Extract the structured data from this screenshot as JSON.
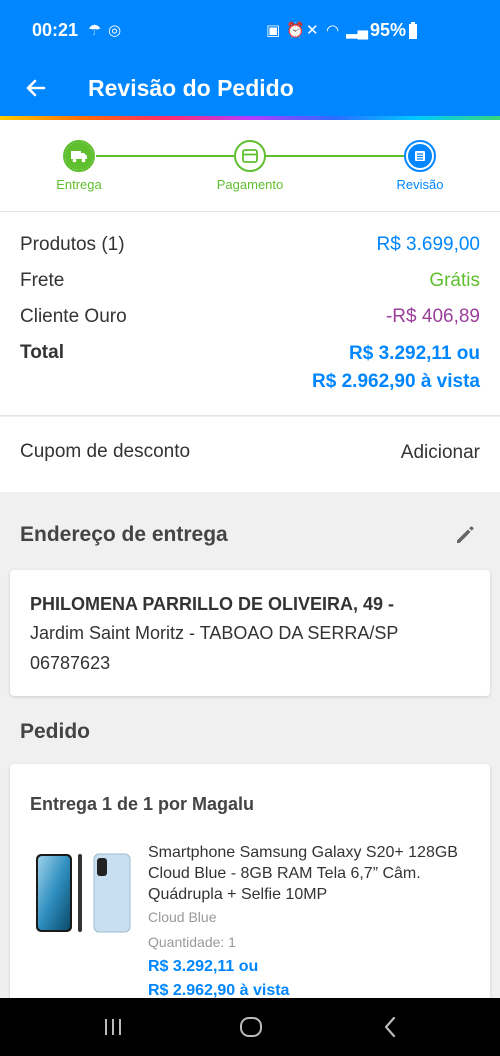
{
  "status_bar": {
    "time": "00:21",
    "battery": "95%"
  },
  "app_bar": {
    "title": "Revisão do Pedido"
  },
  "stepper": {
    "steps": [
      {
        "label": "Entrega"
      },
      {
        "label": "Pagamento"
      },
      {
        "label": "Revisão"
      }
    ]
  },
  "summary": {
    "products_label": "Produtos (1)",
    "products_value": "R$ 3.699,00",
    "shipping_label": "Frete",
    "shipping_value": "Grátis",
    "gold_label": "Cliente Ouro",
    "gold_value": "-R$ 406,89",
    "total_label": "Total",
    "total_value_1": "R$ 3.292,11 ou",
    "total_value_2": "R$ 2.962,90 à vista"
  },
  "coupon": {
    "label": "Cupom de desconto",
    "action": "Adicionar"
  },
  "address_section": {
    "title": "Endereço de entrega",
    "line1": "PHILOMENA PARRILLO DE OLIVEIRA, 49 -",
    "line2": "Jardim Saint Moritz - TABOAO DA SERRA/SP",
    "line3": "06787623"
  },
  "order_section": {
    "title": "Pedido",
    "delivery_title": "Entrega 1 de 1 por Magalu",
    "product_name": "Smartphone Samsung Galaxy S20+ 128GB Cloud Blue - 8GB RAM Tela 6,7” Câm. Quádrupla + Selfie 10MP",
    "variant": "Cloud Blue",
    "quantity": "Quantidade:  1",
    "price_1": "R$ 3.292,11 ou",
    "price_2": "R$ 2.962,90 à vista"
  },
  "colors": {
    "primary": "#0086ff",
    "success": "#5fbf2e",
    "discount": "#9b3f9c"
  },
  "icons": [
    "back-arrow-icon",
    "truck-icon",
    "card-icon",
    "list-icon",
    "edit-pencil-icon",
    "recent-apps-icon",
    "home-icon",
    "back-nav-icon"
  ]
}
